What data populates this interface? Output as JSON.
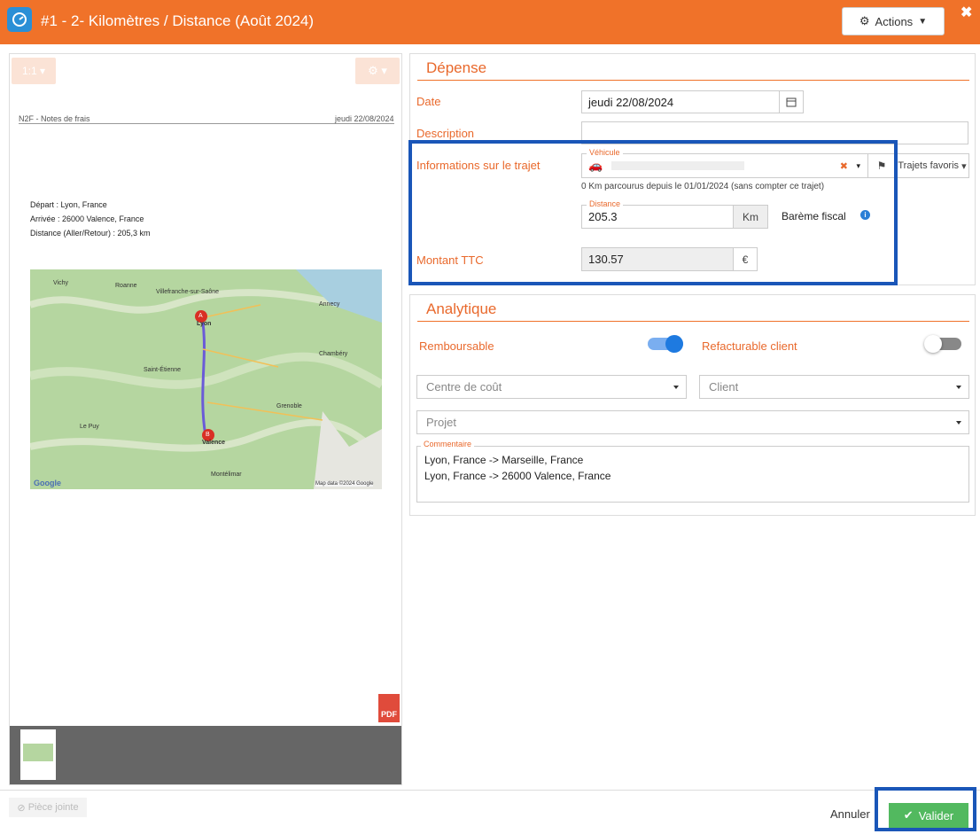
{
  "header": {
    "title": "#1 -  2- Kilomètres / Distance (Août 2024)",
    "actions_label": "Actions",
    "close_label": "✖"
  },
  "viewer": {
    "zoom_label": "1:1",
    "doc_header_left": "N2F - Notes de frais",
    "doc_header_right": "jeudi 22/08/2024",
    "depart": "Départ : Lyon, France",
    "arrivee": "Arrivée : 26000 Valence, France",
    "distance": "Distance (Aller/Retour) : 205,3 km",
    "map": {
      "places": [
        "Lyon",
        "Valence",
        "Roanne",
        "Vichy",
        "Villefranche-sur-Saône",
        "Annecy",
        "Chambéry",
        "Grenoble",
        "Saint-Étienne",
        "Le Puy",
        "Montélimar"
      ],
      "google_label": "Google",
      "credit": "Map data ©2024 Google",
      "marker_a": "A",
      "marker_b": "B"
    },
    "pdf_label": "PDF",
    "attach_label": "Pièce jointe"
  },
  "depense": {
    "title": "Dépense",
    "date_label": "Date",
    "date_value": "jeudi 22/08/2024",
    "description_label": "Description",
    "description_value": "",
    "trajet_label": "Informations sur le trajet",
    "vehicule_label": "Véhicule",
    "trajets_favoris_label": "Trajets favoris",
    "km_note": "0 Km parcourus depuis le 01/01/2024 (sans compter ce trajet)",
    "distance_label": "Distance",
    "distance_value": "205.3",
    "distance_unit": "Km",
    "bareme_label": "Barème fiscal",
    "montant_label": "Montant TTC",
    "montant_value": "130.57",
    "montant_unit": "€"
  },
  "analytique": {
    "title": "Analytique",
    "remboursable_label": "Remboursable",
    "remboursable_on": true,
    "refacturable_label": "Refacturable client",
    "refacturable_on": false,
    "centre_placeholder": "Centre de coût",
    "client_placeholder": "Client",
    "projet_placeholder": "Projet",
    "commentaire_label": "Commentaire",
    "commentaire_lines": [
      "Lyon, France -> Marseille, France",
      "Lyon, France -> 26000 Valence, France"
    ]
  },
  "footer": {
    "cancel_label": "Annuler",
    "validate_label": "Valider"
  },
  "colors": {
    "brand": "#f07229",
    "accent_text": "#e9692c",
    "toggle_on": "#1e7ae0",
    "validate": "#52b95f",
    "highlight": "#1a56b8"
  }
}
